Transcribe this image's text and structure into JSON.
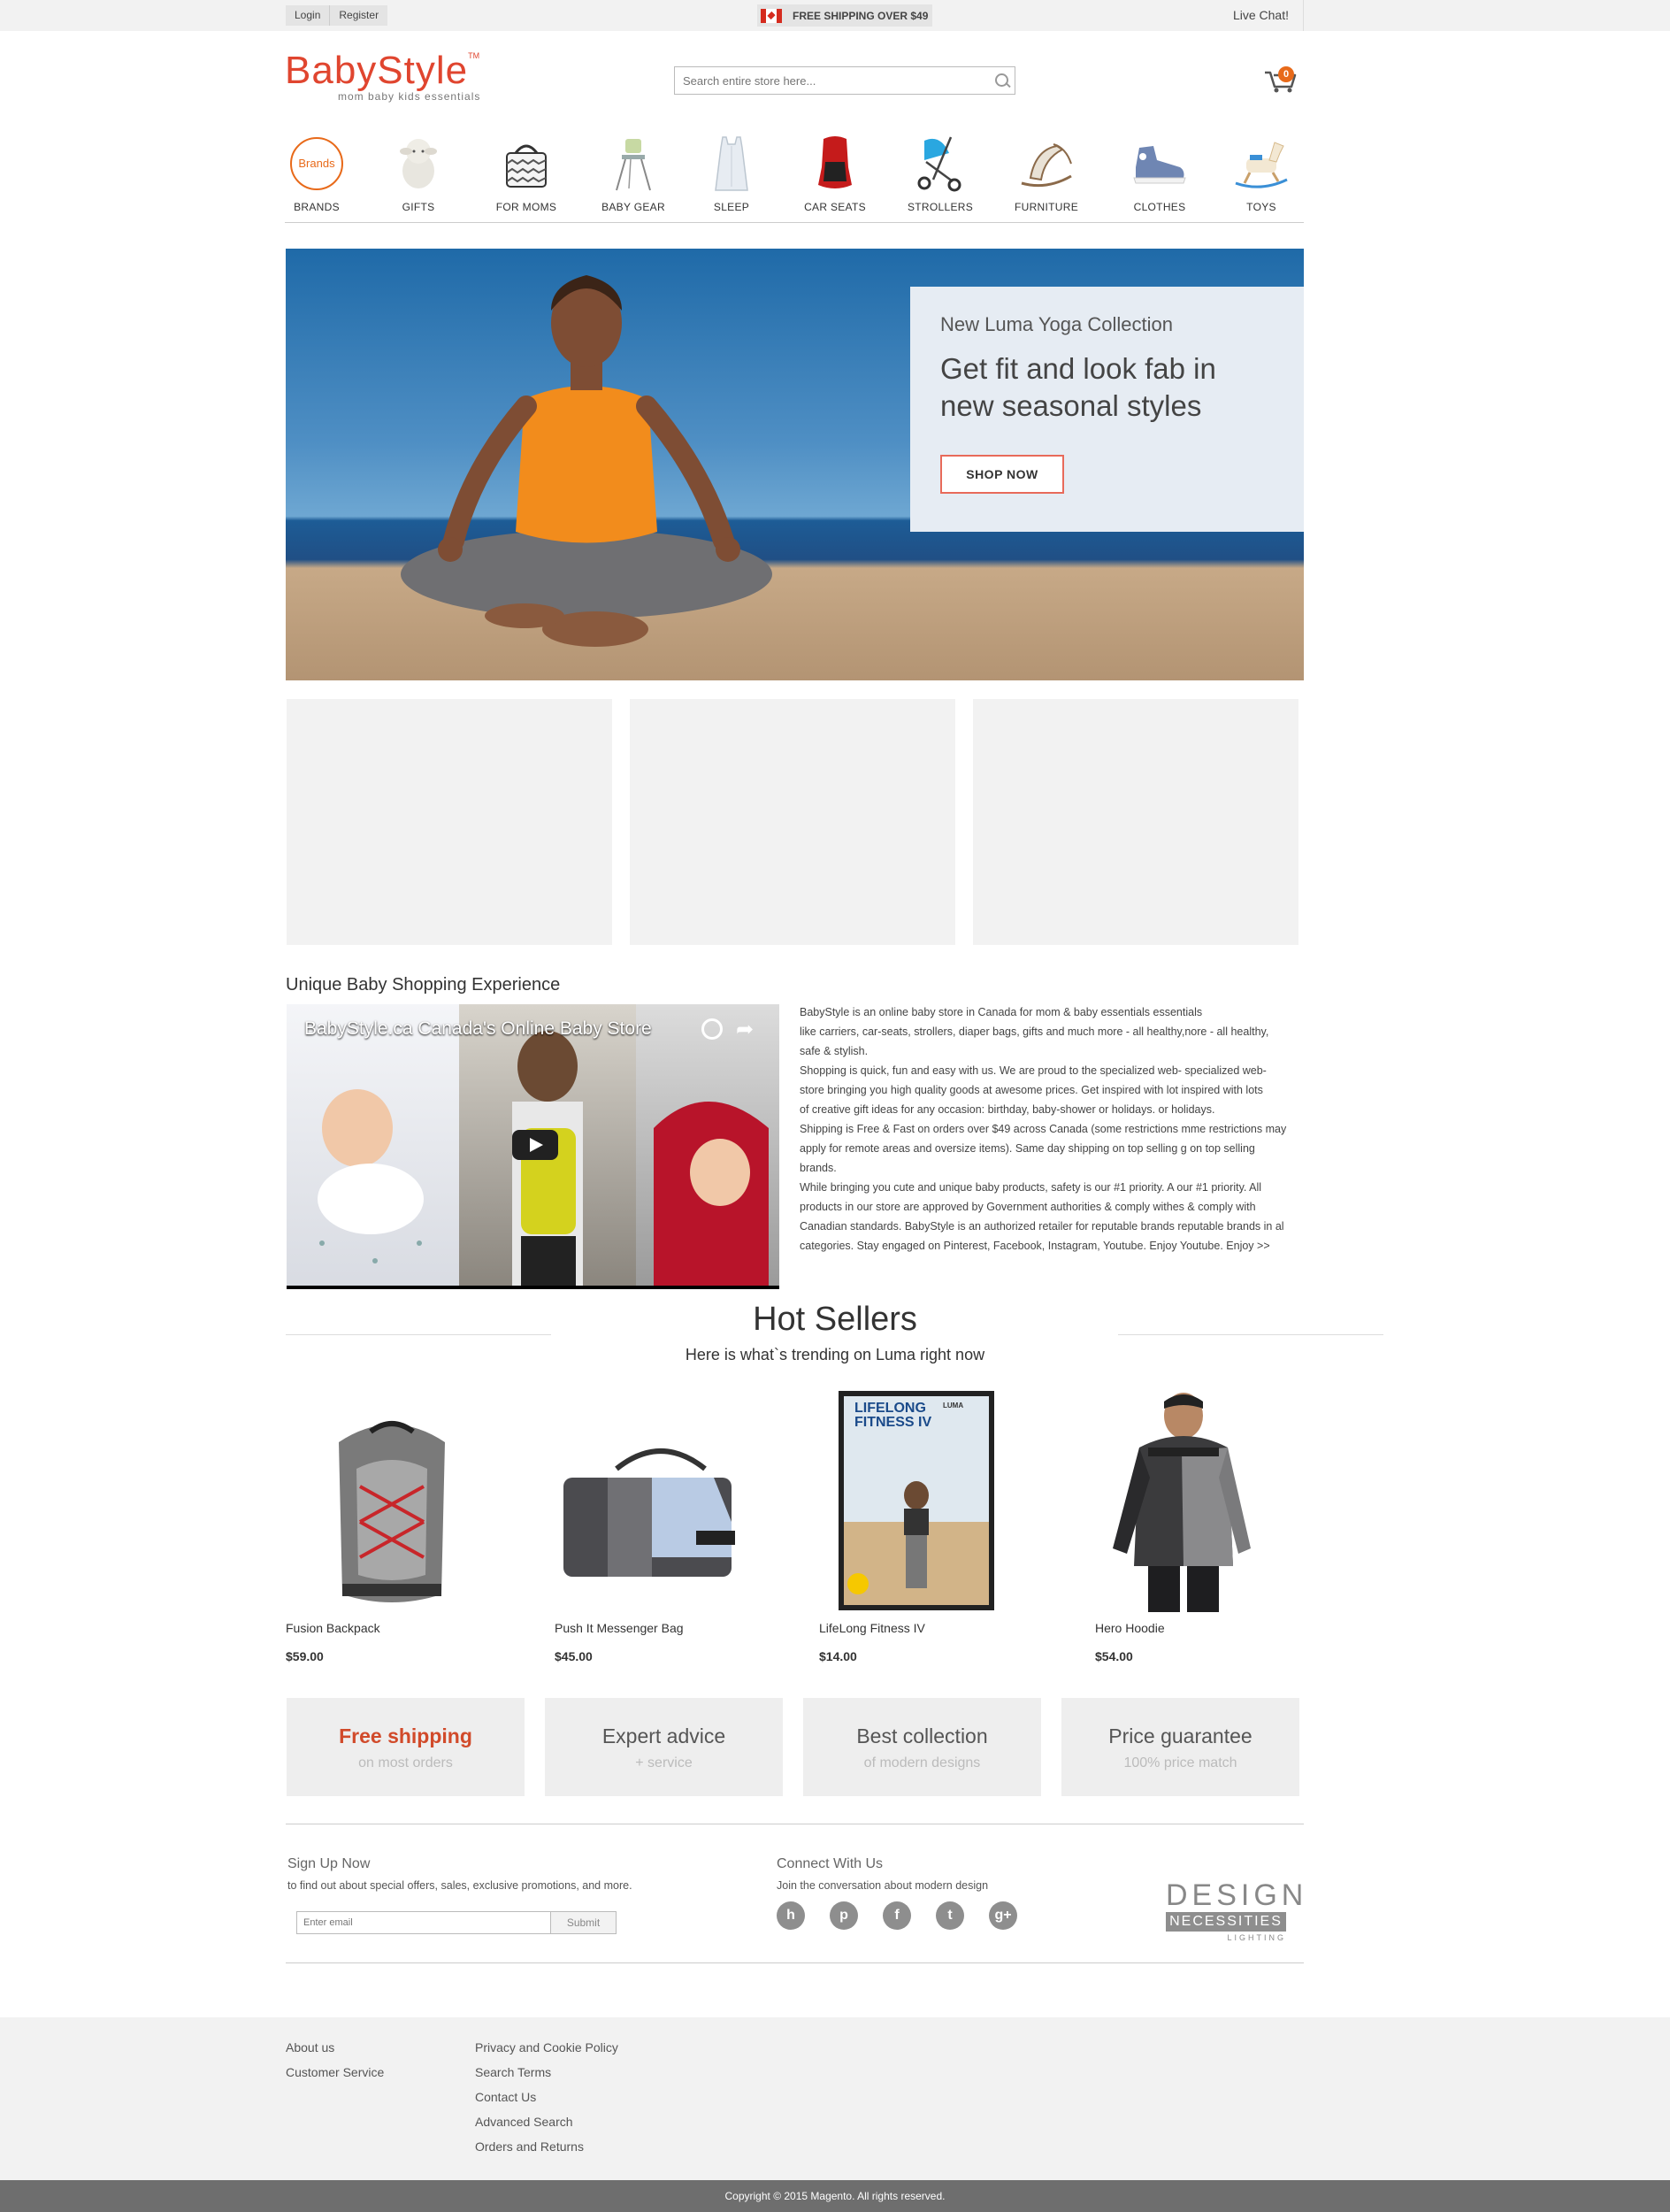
{
  "topbar": {
    "login": "Login",
    "register": "Register",
    "promo": "FREE SHIPPING OVER $49",
    "live_chat": "Live Chat!"
  },
  "header": {
    "logo_name": "BabyStyle",
    "logo_tm": "TM",
    "logo_tagline": "mom baby kids essentials",
    "search_placeholder": "Search entire store here...",
    "cart_count": "0"
  },
  "categories": [
    {
      "label": "BRANDS",
      "icon": "brands-icon",
      "badge": "Brands"
    },
    {
      "label": "GIFTS",
      "icon": "plush-lamb-icon"
    },
    {
      "label": "FOR MOMS",
      "icon": "diaper-bag-icon"
    },
    {
      "label": "BABY GEAR",
      "icon": "high-chair-icon"
    },
    {
      "label": "SLEEP",
      "icon": "sleep-sack-icon"
    },
    {
      "label": "CAR SEATS",
      "icon": "car-seat-icon"
    },
    {
      "label": "STROLLERS",
      "icon": "stroller-icon"
    },
    {
      "label": "FURNITURE",
      "icon": "bouncer-icon"
    },
    {
      "label": "CLOTHES",
      "icon": "sneaker-icon"
    },
    {
      "label": "TOYS",
      "icon": "rocking-horse-icon"
    }
  ],
  "hero": {
    "kicker": "New Luma Yoga Collection",
    "headline": "Get fit and look fab in new seasonal styles",
    "button": "SHOP NOW"
  },
  "unique": {
    "title": "Unique Baby Shopping Experience",
    "video_title": "BabyStyle.ca Canada's Online Baby Store",
    "paragraphs": [
      "BabyStyle is an online baby store in Canada for mom & baby essentials                    essentials",
      "like carriers, car-seats, strollers, diaper bags, gifts and much more - all healthy,nore - all healthy,",
      "safe & stylish.",
      "Shopping is quick, fun and easy with us. We are proud to the specialized web- specialized web-",
      "store bringing you high quality goods at awesome prices. Get inspired with lot inspired with lots",
      "of creative gift ideas for any occasion: birthday, baby-shower or holidays.          or holidays.",
      "Shipping is Free & Fast on orders over $49 across Canada (some restrictions mme restrictions may",
      "apply for remote areas and oversize items). Same day shipping on top selling g on top selling",
      "brands.",
      "While bringing you cute and unique baby products, safety is our #1 priority. A our #1 priority. All",
      "products in our store are approved by Government authorities & comply withes & comply with",
      "Canadian standards. BabyStyle is an authorized retailer for reputable brands reputable brands in al",
      "categories. Stay engaged on Pinterest, Facebook, Instagram, Youtube.  Enjoy  Youtube.   Enjoy >>"
    ]
  },
  "hot_sellers": {
    "title": "Hot Sellers",
    "subtitle": "Here is what`s trending on Luma right now",
    "products": [
      {
        "name": "Fusion Backpack",
        "price": "$59.00",
        "icon": "backpack-icon"
      },
      {
        "name": "Push It Messenger Bag",
        "price": "$45.00",
        "icon": "messenger-bag-icon"
      },
      {
        "name": "LifeLong Fitness IV",
        "price": "$14.00",
        "icon": "dvd-case-icon",
        "cover_title": "LIFELONG FITNESS IV",
        "cover_brand": "LUMA"
      },
      {
        "name": "Hero Hoodie",
        "price": "$54.00",
        "icon": "hoodie-icon"
      }
    ]
  },
  "features": [
    {
      "title": "Free shipping",
      "sub": "on most orders"
    },
    {
      "title": "Expert advice",
      "sub": "+ service"
    },
    {
      "title": "Best collection",
      "sub": "of modern designs"
    },
    {
      "title": "Price guarantee",
      "sub": "100% price match"
    }
  ],
  "signup": {
    "heading": "Sign Up Now",
    "text": "to find out about special offers, sales, exclusive promotions, and more.",
    "placeholder": "Enter email",
    "button": "Submit"
  },
  "connect": {
    "heading": "Connect With Us",
    "text": "Join the conversation about modern design",
    "socials": [
      {
        "name": "houzz-icon",
        "glyph": "h"
      },
      {
        "name": "pinterest-icon",
        "glyph": "p"
      },
      {
        "name": "facebook-icon",
        "glyph": "f"
      },
      {
        "name": "twitter-icon",
        "glyph": "t"
      },
      {
        "name": "google-plus-icon",
        "glyph": "g+"
      }
    ]
  },
  "partner": {
    "line1": "DESIGN",
    "line2": "NECESSITIES",
    "line3": "LIGHTING"
  },
  "footer": {
    "col1": [
      "About us",
      "Customer Service"
    ],
    "col2": [
      "Privacy and Cookie Policy",
      "Search Terms",
      "Contact Us",
      "Advanced Search",
      "Orders and Returns"
    ],
    "copyright": "Copyright © 2015 Magento. All rights reserved."
  },
  "colors": {
    "brand": "#e0452f",
    "accent_orange": "#e86a1a",
    "footer_bg": "#f2f2f2",
    "copyright_bg": "#6e6e6e"
  }
}
